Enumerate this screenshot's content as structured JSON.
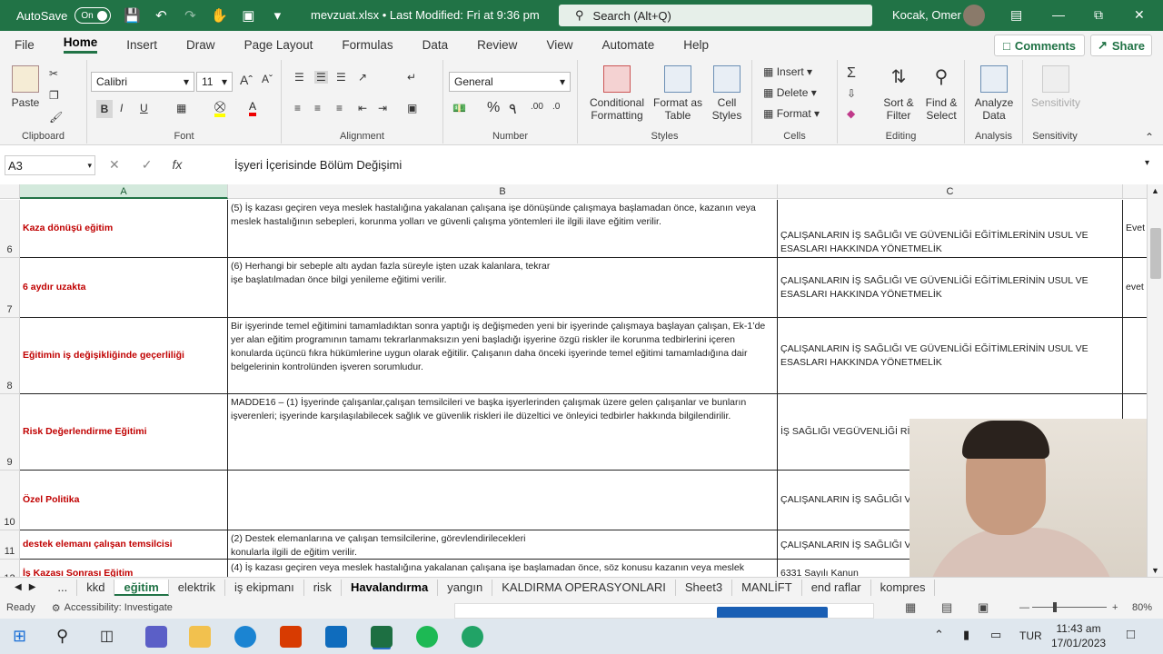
{
  "titlebar": {
    "autosave_label": "AutoSave",
    "autosave_state": "On",
    "file_title": "mevzuat.xlsx • Last Modified: Fri at 9:36 pm",
    "search_placeholder": "Search (Alt+Q)",
    "user_name": "Kocak, Omer"
  },
  "menu": {
    "items": [
      "File",
      "Home",
      "Insert",
      "Draw",
      "Page Layout",
      "Formulas",
      "Data",
      "Review",
      "View",
      "Automate",
      "Help"
    ],
    "comments": "Comments",
    "share": "Share"
  },
  "ribbon": {
    "clipboard": {
      "paste": "Paste",
      "label": "Clipboard"
    },
    "font": {
      "name": "Calibri",
      "size": "11",
      "bold": "B",
      "italic": "I",
      "underline": "U",
      "label": "Font"
    },
    "alignment": {
      "label": "Alignment"
    },
    "number": {
      "format": "General",
      "label": "Number"
    },
    "styles": {
      "conditional": "Conditional",
      "formatting": "Formatting",
      "format_as": "Format as",
      "table": "Table",
      "cell": "Cell",
      "cell_styles": "Styles",
      "label": "Styles"
    },
    "cells": {
      "insert": "Insert",
      "delete": "Delete",
      "format": "Format",
      "label": "Cells"
    },
    "editing": {
      "sort": "Sort &",
      "filter": "Filter",
      "find": "Find &",
      "select": "Select",
      "label": "Editing"
    },
    "analysis": {
      "analyze": "Analyze",
      "data": "Data",
      "label": "Analysis"
    },
    "sensitivity": {
      "btn": "Sensitivity",
      "label": "Sensitivity"
    }
  },
  "formula_bar": {
    "name_box": "A3",
    "formula": "İşyeri İçerisinde Bölüm Değişimi"
  },
  "columns": [
    "A",
    "B",
    "C"
  ],
  "rows": [
    {
      "num": "6",
      "a": "Kaza dönüşü eğitim",
      "b": "(5) İş kazası geçiren veya meslek hastalığına yakalanan çalışana işe dönüşünde çalışmaya başlamadan önce, kazanın veya meslek hastalığının sebepleri, korunma yolları ve güvenli çalışma yöntemleri ile ilgili ilave eğitim verilir.",
      "c": "ÇALIŞANLARIN İŞ SAĞLIĞI VE GÜVENLİĞİ EĞİTİMLERİNİN USUL VE ESASLARI HAKKINDA YÖNETMELİK",
      "d": "Evet"
    },
    {
      "num": "7",
      "a": "6 aydır uzakta",
      "b": "(6) Herhangi bir sebeple altı aydan fazla süreyle işten uzak kalanlara, tekrar işe başlatılmadan önce bilgi yenileme eğitimi verilir.",
      "c": "ÇALIŞANLARIN İŞ SAĞLIĞI VE GÜVENLİĞİ EĞİTİMLERİNİN USUL VE ESASLARI HAKKINDA YÖNETMELİK",
      "d": "evet"
    },
    {
      "num": "8",
      "a": "Eğitimin iş değişikliğinde geçerliliği",
      "b": "Bir işyerinde temel eğitimini tamamladıktan sonra yaptığı iş değişmeden yeni bir işyerinde çalışmaya başlayan çalışan, Ek-1’de yer alan eğitim programının tamamı tekrarlanmaksızın yeni başladığı işyerine özgü riskler ile korunma tedbirlerini içeren konularda üçüncü fıkra hükümlerine uygun olarak eğitilir. Çalışanın daha önceki işyerinde temel eğitimi tamamladığına dair belgelerinin kontrolünden işveren sorumludur.",
      "c": "ÇALIŞANLARIN İŞ SAĞLIĞI VE GÜVENLİĞİ EĞİTİMLERİNİN USUL VE ESASLARI HAKKINDA YÖNETMELİK",
      "d": ""
    },
    {
      "num": "9",
      "a": "Risk Değerlendirme Eğitimi",
      "b": "MADDE16 – (1) İşyerinde çalışanlar,çalışan temsilcileri ve başka işyerlerinden çalışmak üzere gelen çalışanlar ve bunların işverenleri; işyerinde karşılaşılabilecek sağlık ve güvenlik riskleri ile düzeltici ve önleyici tedbirler hakkında bilgilendirilir.",
      "c": "İŞ SAĞLIĞI VEGÜVENLİĞİ RİSK",
      "d": ""
    },
    {
      "num": "10",
      "a": "Özel Politika",
      "b": "",
      "c": "ÇALIŞANLARIN İŞ SAĞLIĞI VE GÜVENLİĞİ EĞİTİMLERİNİN U",
      "d": ""
    },
    {
      "num": "11",
      "a": "destek elemanı çalışan temsilcisi",
      "b": "(2) Destek elemanlarına ve çalışan temsilcilerine, görevlendirilecekleri konularla ilgili de eğitim verilir.",
      "c": "ÇALIŞANLARIN İŞ SAĞLIĞI VE GÜVENLİĞİ EĞİTİMLERİNİN U",
      "d": ""
    },
    {
      "num": "12",
      "a": "İş Kazası Sonrası Eğitim",
      "b": "(4) İş kazası geçiren veya meslek hastalığına yakalanan çalışana işe başlamadan önce, söz konusu kazanın veya meslek",
      "c": "6331 Sayılı Kanun",
      "d": ""
    }
  ],
  "sheet_tabs": [
    "...",
    "kkd",
    "eğitim",
    "elektrik",
    "iş ekipmanı",
    "risk",
    "Havalandırma",
    "yangın",
    "KALDIRMA OPERASYONLARI",
    "Sheet3",
    "MANLİFT",
    "end raflar",
    "kompres"
  ],
  "active_tab": "eğitim",
  "status": {
    "ready": "Ready",
    "accessibility": "Accessibility: Investigate",
    "zoom": "80%"
  },
  "taskbar": {
    "lang": "TUR",
    "time": "11:43 am",
    "date": "17/01/2023"
  },
  "colors": {
    "excel_green": "#217346",
    "red_text": "#c00000"
  }
}
